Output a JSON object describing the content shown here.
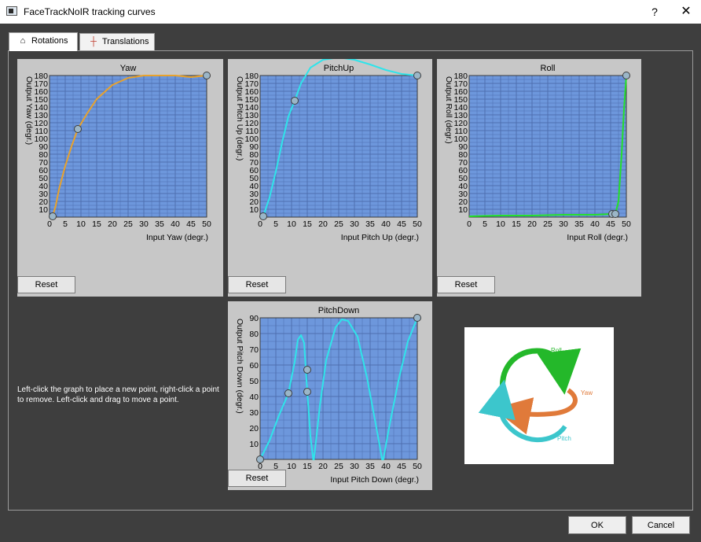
{
  "window": {
    "title": "FaceTrackNoIR tracking curves",
    "help": "?",
    "close": "✕"
  },
  "tabs": [
    {
      "label": "Rotations"
    },
    {
      "label": "Translations"
    }
  ],
  "charts": [
    {
      "id": "yaw",
      "title": "Yaw",
      "xlabel": "Input Yaw (degr.)",
      "ylabel": "Output Yaw (degr.)",
      "ymax": 180,
      "ystep": 10,
      "xmax": 50,
      "xstep": 5,
      "color": "#e8a22c",
      "points": [
        [
          1,
          1
        ],
        [
          9,
          112
        ],
        [
          50,
          180
        ]
      ],
      "curve": [
        [
          0,
          0
        ],
        [
          1,
          1
        ],
        [
          2,
          15
        ],
        [
          3,
          35
        ],
        [
          5,
          65
        ],
        [
          7,
          90
        ],
        [
          9,
          112
        ],
        [
          12,
          132
        ],
        [
          15,
          150
        ],
        [
          20,
          168
        ],
        [
          25,
          177
        ],
        [
          30,
          180
        ],
        [
          35,
          180
        ],
        [
          40,
          180
        ],
        [
          45,
          178
        ],
        [
          50,
          180
        ]
      ]
    },
    {
      "id": "pitchup",
      "title": "PitchUp",
      "xlabel": "Input Pitch Up (degr.)",
      "ylabel": "Output Pitch Up (degr.)",
      "ymax": 180,
      "ystep": 10,
      "xmax": 50,
      "xstep": 5,
      "color": "#2fe4ea",
      "points": [
        [
          1,
          1
        ],
        [
          11,
          148
        ],
        [
          50,
          180
        ]
      ],
      "curve": [
        [
          1,
          1
        ],
        [
          3,
          25
        ],
        [
          5,
          58
        ],
        [
          7,
          95
        ],
        [
          9,
          128
        ],
        [
          11,
          148
        ],
        [
          13,
          170
        ],
        [
          16,
          190
        ],
        [
          20,
          200
        ],
        [
          25,
          203
        ],
        [
          30,
          200
        ],
        [
          35,
          194
        ],
        [
          40,
          187
        ],
        [
          45,
          182
        ],
        [
          50,
          180
        ]
      ]
    },
    {
      "id": "roll",
      "title": "Roll",
      "xlabel": "Input Roll (degr.)",
      "ylabel": "Output Roll (degr.)",
      "ymax": 180,
      "ystep": 10,
      "xmax": 50,
      "xstep": 5,
      "color": "#25e02a",
      "points": [
        [
          45.5,
          4
        ],
        [
          46.5,
          4
        ],
        [
          50,
          180
        ]
      ],
      "curve": [
        [
          0,
          1
        ],
        [
          10,
          2
        ],
        [
          20,
          2
        ],
        [
          30,
          3
        ],
        [
          40,
          3
        ],
        [
          45.5,
          4
        ],
        [
          46.5,
          4
        ],
        [
          47.5,
          20
        ],
        [
          48.5,
          80
        ],
        [
          49.3,
          140
        ],
        [
          50,
          180
        ]
      ]
    },
    {
      "id": "pitchdown",
      "title": "PitchDown",
      "xlabel": "Input Pitch Down (degr.)",
      "ylabel": "Output Pitch Down (degr.)",
      "ymax": 90,
      "ystep": 10,
      "xmax": 50,
      "xstep": 5,
      "color": "#2fe4ea",
      "points": [
        [
          0,
          0
        ],
        [
          9,
          42
        ],
        [
          15,
          57
        ],
        [
          15,
          43
        ],
        [
          50,
          90
        ]
      ],
      "curve": [
        [
          0,
          0
        ],
        [
          3,
          12
        ],
        [
          6,
          28
        ],
        [
          9,
          42
        ],
        [
          11,
          62
        ],
        [
          12,
          76
        ],
        [
          13,
          79
        ],
        [
          14,
          74
        ],
        [
          15,
          43
        ],
        [
          16,
          15
        ],
        [
          17,
          -2
        ],
        [
          19,
          34
        ],
        [
          21,
          63
        ],
        [
          24,
          84
        ],
        [
          26,
          89
        ],
        [
          28,
          88
        ],
        [
          31,
          78
        ],
        [
          34,
          52
        ],
        [
          37,
          20
        ],
        [
          39,
          -2
        ],
        [
          41,
          20
        ],
        [
          44,
          50
        ],
        [
          47,
          75
        ],
        [
          50,
          90
        ]
      ]
    }
  ],
  "reset_label": "Reset",
  "help_text": "Left-click the graph to place a new point, right-click a point to remove. Left-click and drag to move a point.",
  "image_labels": {
    "roll": "Roll",
    "yaw": "Yaw",
    "pitch": "Pitch"
  },
  "buttons": {
    "ok": "OK",
    "cancel": "Cancel"
  },
  "colors": {
    "plot_bg": "#6d97dc",
    "panel_bg": "#c7c7c7",
    "dialog_bg": "#3e3e3e",
    "grid": "#4f6fb0"
  }
}
